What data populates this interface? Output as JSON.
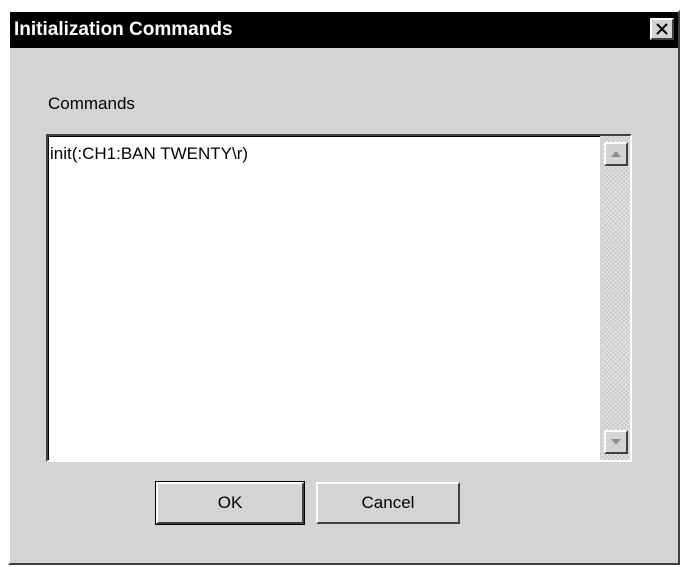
{
  "window": {
    "title": "Initialization Commands",
    "close_glyph": "✕"
  },
  "form": {
    "commands_label": "Commands",
    "commands_value": "init(:CH1:BAN TWENTY\\r)"
  },
  "scrollbar": {
    "up_icon": "scroll-up-arrow-icon",
    "down_icon": "scroll-down-arrow-icon"
  },
  "buttons": {
    "ok_label": "OK",
    "cancel_label": "Cancel"
  },
  "colors": {
    "title_bar": "#000000",
    "title_text": "#ffffff",
    "dialog_face": "#d4d4d4",
    "text_area": "#ffffff"
  }
}
